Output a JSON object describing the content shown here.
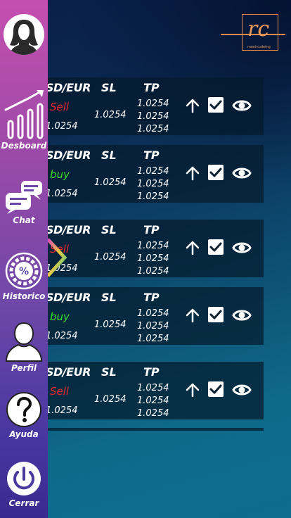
{
  "logo": {
    "mark": "rc",
    "tagline": "meninudeing"
  },
  "sidebar": {
    "items": [
      {
        "label": "Desboard",
        "icon": "bar-chart-trend-icon"
      },
      {
        "label": "Chat",
        "icon": "chat-bubbles-icon"
      },
      {
        "label": "Historico",
        "icon": "percent-gauge-icon"
      },
      {
        "label": "Perfil",
        "icon": "user-silhouette-icon"
      },
      {
        "label": "Ayuda",
        "icon": "question-circle-icon"
      },
      {
        "label": "Cerrar",
        "icon": "power-icon"
      }
    ]
  },
  "columns": {
    "pair": "SD/EUR",
    "sl": "SL",
    "tp": "TP"
  },
  "trades": [
    {
      "side": "Sell",
      "pair_value": "1.0254",
      "sl": "1.0254",
      "tp": [
        "1.0254",
        "1.0254",
        "1.0254"
      ]
    },
    {
      "side": "buy",
      "pair_value": "1.0254",
      "sl": "1.0254",
      "tp": [
        "1.0254",
        "1.0254",
        "1.0254"
      ]
    },
    {
      "side": "Sell",
      "pair_value": "1.0254",
      "sl": "1.0254",
      "tp": [
        "1.0254",
        "1.0254",
        "1.0254"
      ]
    },
    {
      "side": "buy",
      "pair_value": "1.0254",
      "sl": "1.0254",
      "tp": [
        "1.0254",
        "1.0254",
        "1.0254"
      ]
    },
    {
      "side": "Sell",
      "pair_value": "1.0254",
      "sl": "1.0254",
      "tp": [
        "1.0254",
        "1.0254",
        "1.0254"
      ]
    }
  ],
  "colors": {
    "sell": "#e8282e",
    "buy": "#34e024",
    "logo": "#e89a5a"
  }
}
